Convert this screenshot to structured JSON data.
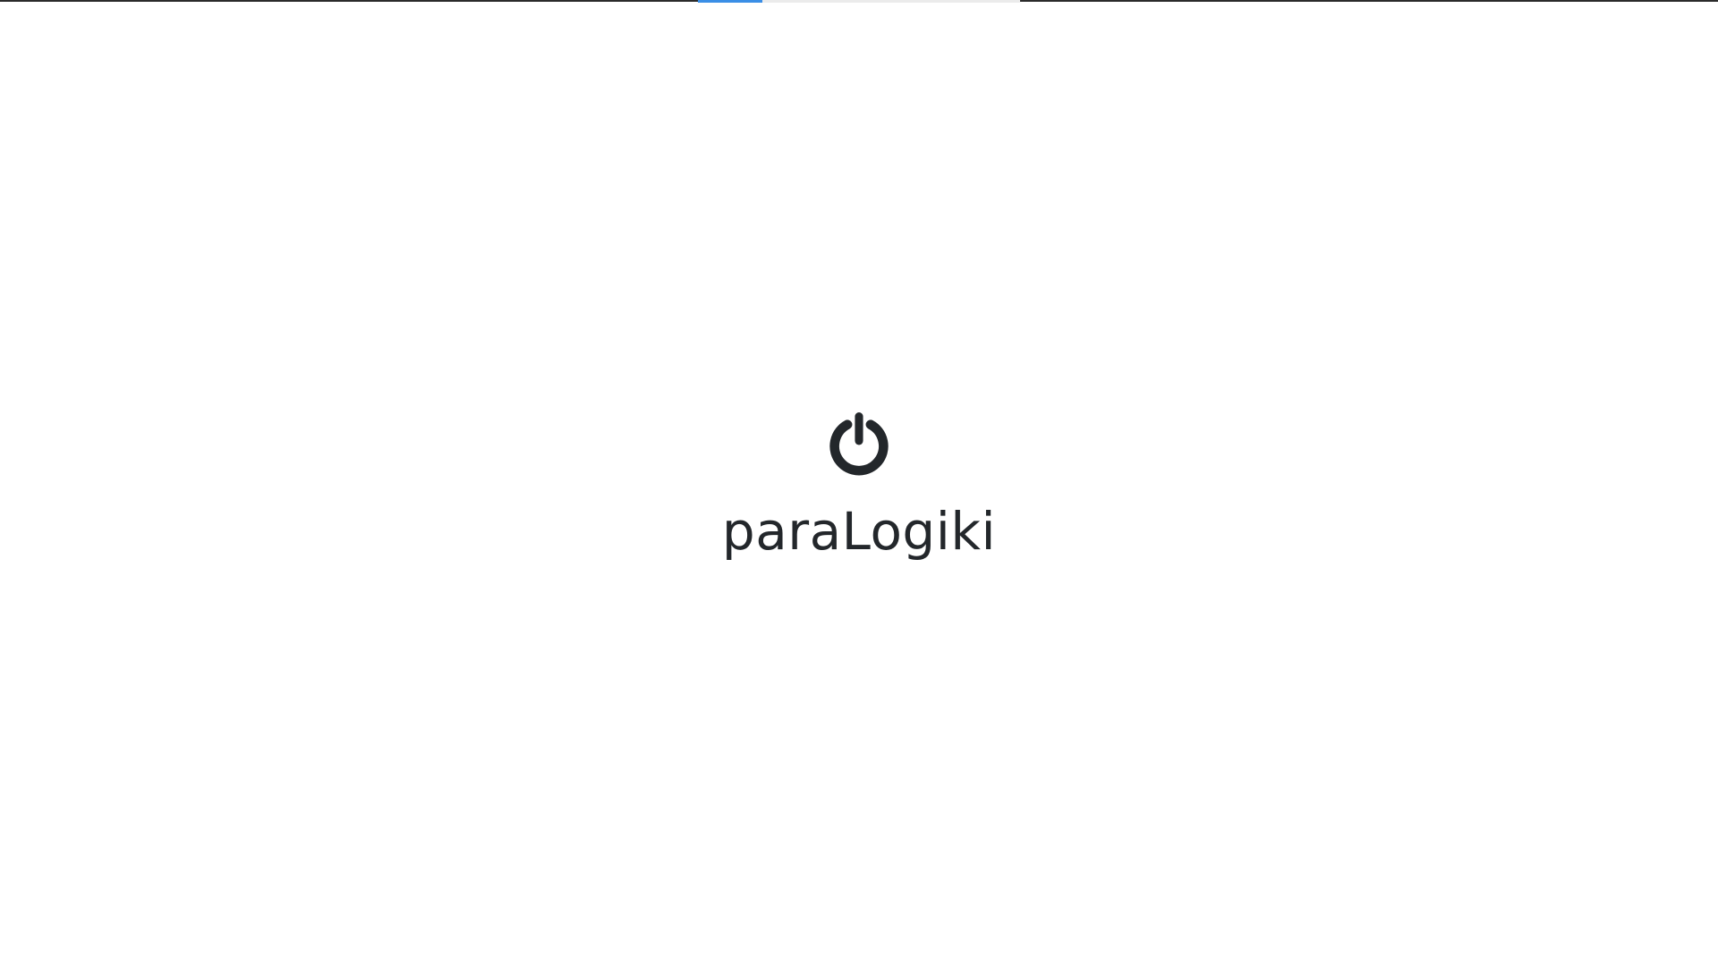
{
  "app": {
    "name": "paraLogiki",
    "icon": "power-icon"
  },
  "loading": {
    "progress": 0.2
  },
  "colors": {
    "background": "#ffffff",
    "text": "#23272b",
    "accent": "#3a8ee6",
    "track": "#ebebeb",
    "top_line": "#2b2b2b"
  }
}
